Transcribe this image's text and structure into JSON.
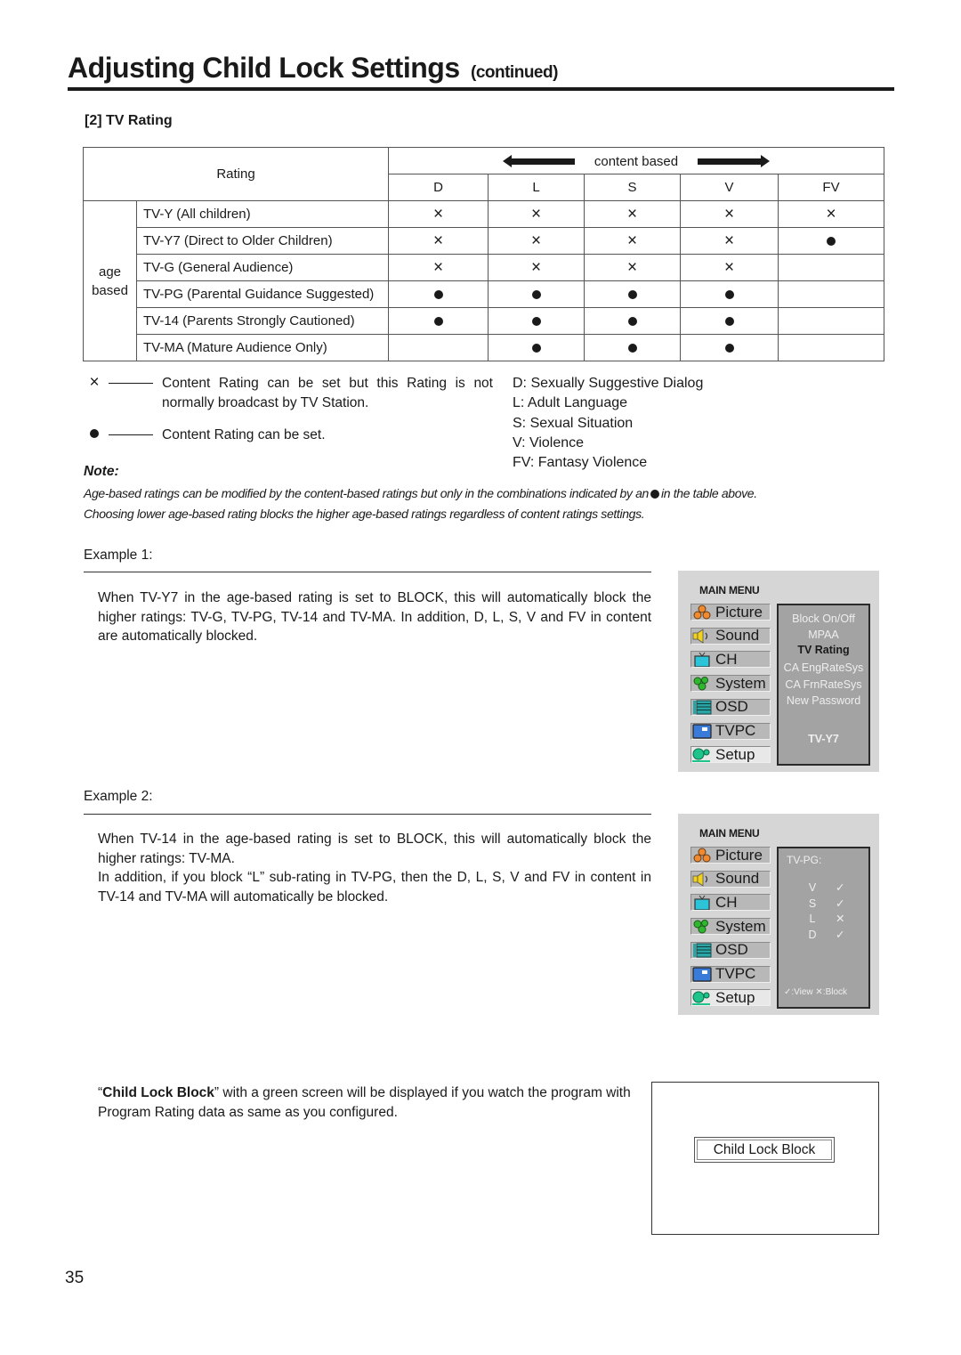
{
  "header": {
    "title": "Adjusting Child Lock Settings",
    "title_suffix": "(continued)",
    "section": "[2] TV Rating"
  },
  "table": {
    "rating_header": "Rating",
    "content_based_label": "content based",
    "age_group_label_1": "age",
    "age_group_label_2": "based",
    "columns": [
      "D",
      "L",
      "S",
      "V",
      "FV"
    ],
    "rows": [
      {
        "name": "TV-Y (All children)",
        "cells": [
          "x",
          "x",
          "x",
          "x",
          "x"
        ]
      },
      {
        "name": "TV-Y7 (Direct to Older Children)",
        "cells": [
          "x",
          "x",
          "x",
          "x",
          "dot"
        ]
      },
      {
        "name": "TV-G (General Audience)",
        "cells": [
          "x",
          "x",
          "x",
          "x",
          ""
        ]
      },
      {
        "name": "TV-PG (Parental Guidance Suggested)",
        "cells": [
          "dot",
          "dot",
          "dot",
          "dot",
          ""
        ]
      },
      {
        "name": "TV-14 (Parents Strongly Cautioned)",
        "cells": [
          "dot",
          "dot",
          "dot",
          "dot",
          ""
        ]
      },
      {
        "name": "TV-MA (Mature Audience Only)",
        "cells": [
          "",
          "dot",
          "dot",
          "dot",
          ""
        ]
      }
    ]
  },
  "legend": {
    "x_symbol": "×",
    "x_text": "Content Rating can be set but this Rating is not normally broadcast by TV Station.",
    "dot_text": "Content Rating can be set.",
    "abbreviations": [
      "D: Sexually Suggestive Dialog",
      "L: Adult  Language",
      "S: Sexual Situation",
      "V: Violence",
      "FV: Fantasy Violence"
    ]
  },
  "note": {
    "label": "Note:",
    "line1_before": "Age-based ratings can be modified by the content-based ratings but only in the combinations indicated by an",
    "line1_after": "in the table above.",
    "line2": "Choosing lower age-based rating blocks the higher age-based ratings regardless of content ratings settings."
  },
  "example1": {
    "label": "Example 1:",
    "body": "When TV-Y7 in the age-based rating is set to BLOCK, this will automatically block the higher ratings: TV-G, TV-PG, TV-14 and TV-MA. In addition, D, L, S, V and FV in content are automatically blocked."
  },
  "example2": {
    "label": "Example 2:",
    "body_line1": "When TV-14 in the age-based rating is set to BLOCK, this will automatically block the higher ratings: TV-MA.",
    "body_line2": "In addition, if you block “L” sub-rating in TV-PG, then the D, L, S, V and FV in content in TV-14 and TV-MA will automatically be blocked."
  },
  "menu": {
    "title": "MAIN MENU",
    "items": [
      {
        "label": "Picture",
        "icon": "picture-icon"
      },
      {
        "label": "Sound",
        "icon": "speaker-icon"
      },
      {
        "label": "CH",
        "icon": "tv-icon"
      },
      {
        "label": "System",
        "icon": "gears-icon"
      },
      {
        "label": "OSD",
        "icon": "list-icon"
      },
      {
        "label": "TVPC",
        "icon": "monitor-icon"
      },
      {
        "label": "Setup",
        "icon": "setup-icon"
      }
    ],
    "selected": "Setup"
  },
  "menu1_panel": {
    "options": [
      "Block On/Off",
      "MPAA",
      "TV Rating",
      "CA EngRateSys",
      "CA FrnRateSys",
      "New Password"
    ],
    "active_option": "TV Rating",
    "current_value": "TV-Y7"
  },
  "menu2_panel": {
    "title": "TV-PG:",
    "subratings": [
      {
        "code": "V",
        "state": "✓"
      },
      {
        "code": "S",
        "state": "✓"
      },
      {
        "code": "L",
        "state": "✕"
      },
      {
        "code": "D",
        "state": "✓"
      }
    ],
    "legend": "✓:View ✕:Block"
  },
  "child_lock": {
    "desc_bold": "Child Lock Block",
    "desc_rest": "” with a green screen will be displayed if you watch the program with Program Rating data as same as you configured.",
    "open_quote": "“",
    "screen_label": "Child Lock Block"
  },
  "page_number": "35"
}
